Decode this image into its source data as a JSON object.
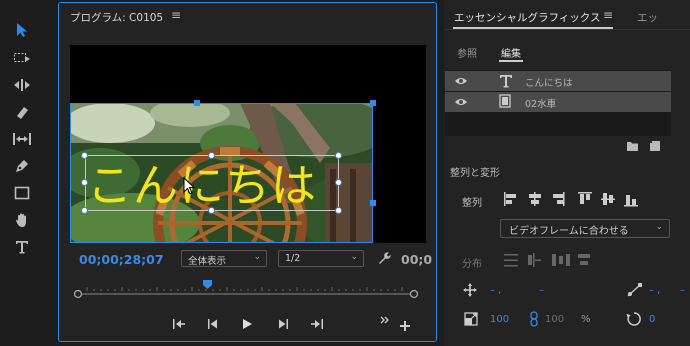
{
  "program_panel": {
    "title": "プログラム: C0105",
    "menu_icon": "≡",
    "overlay_text": "こんにちは",
    "timecode": "00;00;28;07",
    "zoom_select": "全体表示",
    "resolution_select": "1/2",
    "timecode_right": "00;0"
  },
  "graphics_panel": {
    "title": "エッセンシャルグラフィックス",
    "menu_icon": "≡",
    "tab2": "エッ",
    "tabs": {
      "browse": "参照",
      "edit": "編集"
    },
    "layers": [
      {
        "name": "こんにちは",
        "type": "text-icon"
      },
      {
        "name": "02水車",
        "type": "film-icon"
      }
    ],
    "section": "整列と変形",
    "align_label": "整列",
    "frame_select": "ビデオフレームに合わせる",
    "distribute_label": "分布",
    "position": {
      "x": "– ,",
      "y": "–"
    },
    "anchor": {
      "x": "– ,",
      "y": "–"
    },
    "scale": "100",
    "scale_locked": "100",
    "percent": "%",
    "rotation": "0"
  },
  "colors": {
    "accent_blue": "#2d8ceb",
    "text_yellow": "#f3e51b",
    "timecode_blue": "#3d88e6"
  }
}
